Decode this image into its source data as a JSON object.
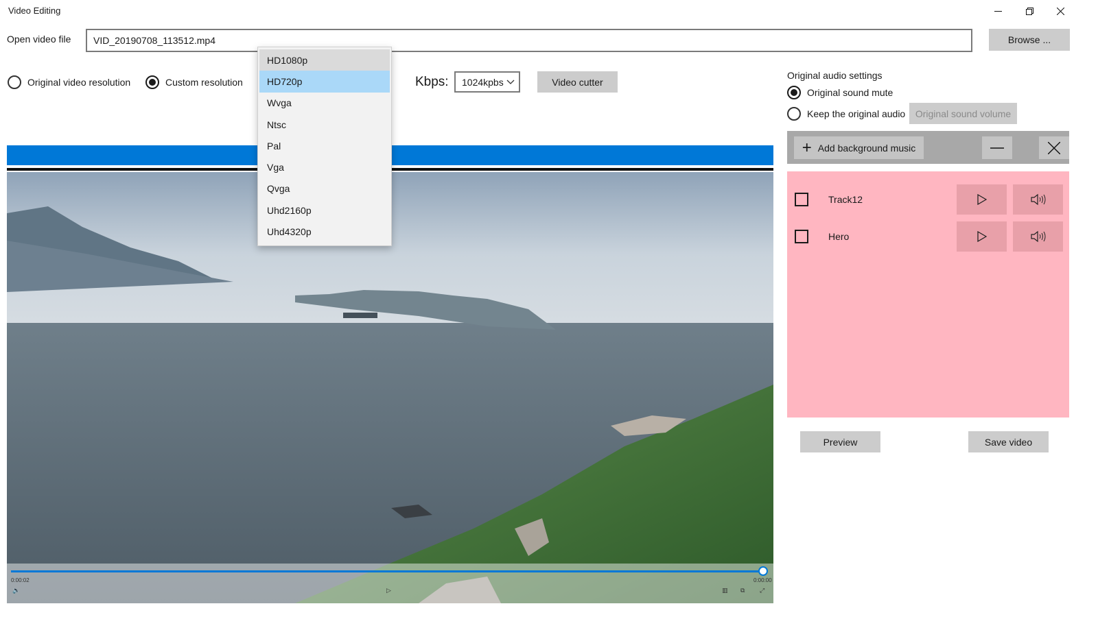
{
  "window": {
    "title": "Video Editing",
    "minimize_icon": "minimize-icon",
    "restore_icon": "restore-icon",
    "close_icon": "close-icon"
  },
  "file": {
    "label": "Open video file",
    "value": "VID_20190708_113512.mp4",
    "browse_label": "Browse ..."
  },
  "resolution": {
    "original_label": "Original video resolution",
    "custom_label": "Custom resolution",
    "selected": "custom",
    "options": [
      "HD1080p",
      "HD720p",
      "Wvga",
      "Ntsc",
      "Pal",
      "Vga",
      "Qvga",
      "Uhd2160p",
      "Uhd4320p"
    ],
    "highlighted": "HD720p",
    "hovered": "HD1080p"
  },
  "kbps": {
    "label": "Kbps:",
    "value": "1024kpbs"
  },
  "video_cutter_label": "Video cutter",
  "player": {
    "current_time": "0:00:02",
    "end_time": "0:00:00",
    "progress": 0.99
  },
  "audio": {
    "title": "Original audio settings",
    "mute_label": "Original sound mute",
    "keep_label": "Keep the original audio",
    "selected": "mute",
    "volume_button": "Original sound volume",
    "add_music_label": "Add background music",
    "tracks": [
      {
        "name": "Track12",
        "checked": false
      },
      {
        "name": "Hero",
        "checked": false
      }
    ]
  },
  "actions": {
    "preview_label": "Preview",
    "save_label": "Save video"
  },
  "colors": {
    "accent": "#0078d7",
    "track_panel": "#ffb6c1",
    "button_gray": "#cccccc",
    "dropdown_selected": "#aad8f8"
  }
}
